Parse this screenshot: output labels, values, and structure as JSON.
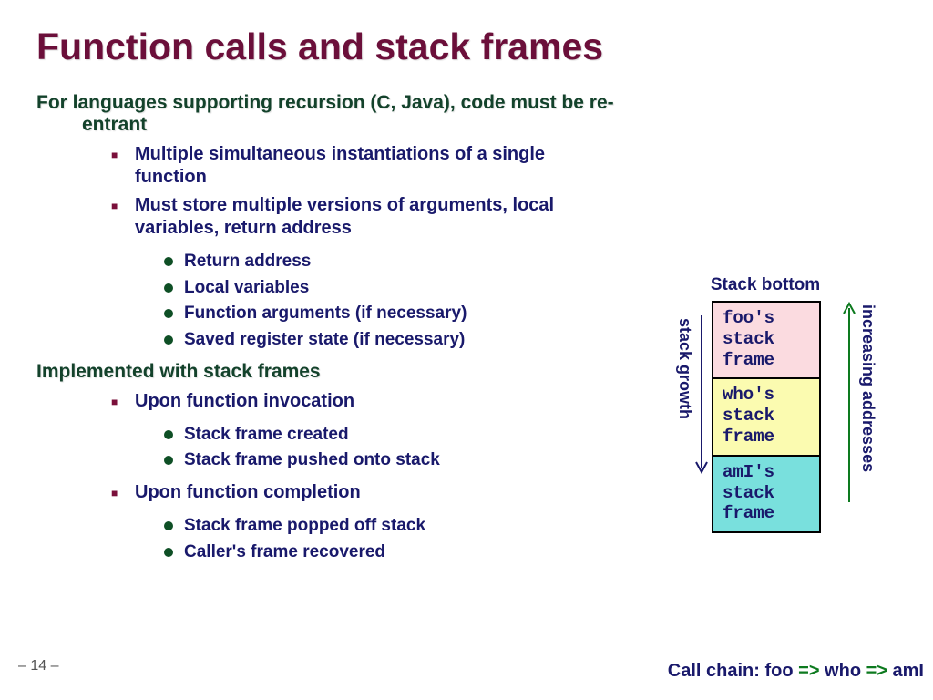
{
  "title": "Function calls and stack frames",
  "lead1": "For languages supporting recursion (C, Java), code must be re-entrant",
  "l1a": [
    "Multiple simultaneous instantiations of a single function",
    "Must store multiple versions of arguments, local variables, return address"
  ],
  "l2a": [
    "Return address",
    "Local variables",
    "Function arguments (if necessary)",
    "Saved register state (if necessary)"
  ],
  "lead2": "Implemented with stack frames",
  "l1b": [
    "Upon function invocation"
  ],
  "l2b": [
    "Stack frame created",
    "Stack frame pushed onto stack"
  ],
  "l1c": [
    "Upon function completion"
  ],
  "l2c": [
    "Stack frame popped off stack",
    "Caller's frame recovered"
  ],
  "pagenum": "– 14 –",
  "diagram": {
    "stack_bottom": "Stack bottom",
    "frames": [
      "foo's\nstack\nframe",
      "who's\nstack\nframe",
      "amI's\nstack\nframe"
    ],
    "growth_label": "stack growth",
    "addr_label": "increasing addresses",
    "call_chain_prefix": "Call chain: foo ",
    "arrow1": "=>",
    "mid": " who ",
    "arrow2": "=>",
    "end": " amI"
  }
}
